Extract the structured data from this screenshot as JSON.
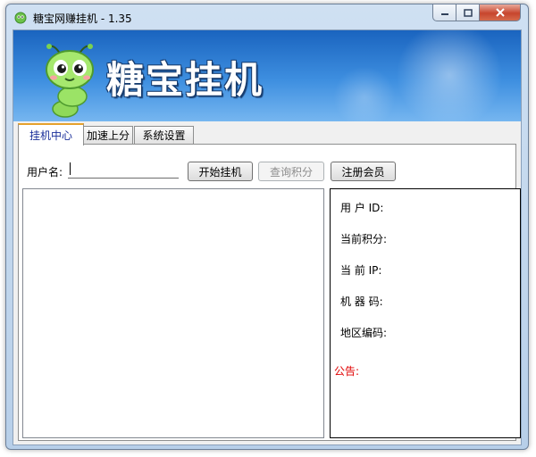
{
  "window": {
    "title": "糖宝网赚挂机 - 1.35",
    "controls": {
      "minimize": "minimize",
      "maximize": "maximize",
      "close": "close"
    }
  },
  "banner": {
    "title": "糖宝挂机",
    "mascot_icon": "green-bug-mascot-icon"
  },
  "tabs": [
    {
      "label": "挂机中心",
      "active": true
    },
    {
      "label": "加速上分",
      "active": false
    },
    {
      "label": "系统设置",
      "active": false
    }
  ],
  "form": {
    "username_label": "用户名:",
    "username_value": "",
    "start_button": "开始挂机",
    "query_button": "查询积分",
    "query_disabled": true,
    "register_button": "注册会员"
  },
  "info": {
    "user_id_label": "用 户 ID:",
    "user_id_value": "",
    "points_label": "当前积分:",
    "points_value": "",
    "ip_label": "当 前 IP:",
    "ip_value": "",
    "machine_label": "机 器 码:",
    "machine_value": "",
    "region_label": "地区编码:",
    "region_value": "",
    "notice_label": "公告:"
  },
  "colors": {
    "banner": "#3e8fe0",
    "active_tab_text": "#1a2f9a",
    "notice": "#e00000"
  }
}
